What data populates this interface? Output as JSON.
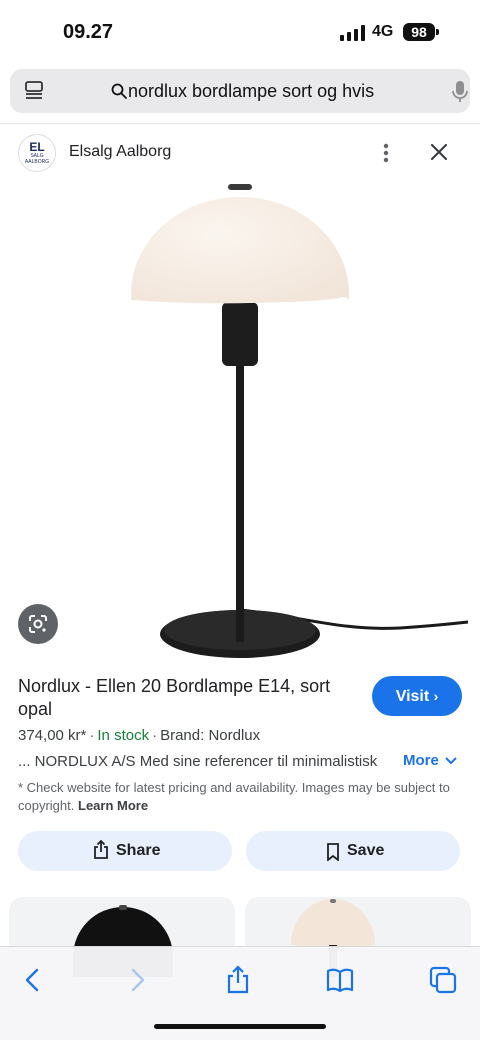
{
  "status_bar": {
    "time": "09.27",
    "network": "4G",
    "battery": "98"
  },
  "address_bar": {
    "query": "nordlux bordlampe sort og hvis"
  },
  "source": {
    "logo_text": "EL",
    "logo_sub": "SALG AALBORG",
    "name": "Elsalg Aalborg"
  },
  "product": {
    "title": "Nordlux - Ellen 20 Bordlampe E14, sort opal",
    "price": "374,00 kr*",
    "stock": "In stock",
    "brand": "Brand: Nordlux",
    "description": "... NORDLUX A/S Med sine referencer til minimalistisk",
    "more_label": "More",
    "disclaimer": "* Check website for latest pricing and availability. Images may be subject to copyright.",
    "learn_more": "Learn More"
  },
  "actions": {
    "visit": "Visit",
    "share": "Share",
    "save": "Save"
  },
  "colors": {
    "accent": "#1a73e8",
    "stock_green": "#188038",
    "button_tint": "#e8f0fe"
  },
  "icons": [
    "tabs-icon",
    "search-icon",
    "mic-icon",
    "more-vert-icon",
    "close-icon",
    "lens-icon",
    "share-icon",
    "bookmark-icon",
    "back-icon",
    "forward-icon",
    "book-icon",
    "tabs-overview-icon"
  ]
}
